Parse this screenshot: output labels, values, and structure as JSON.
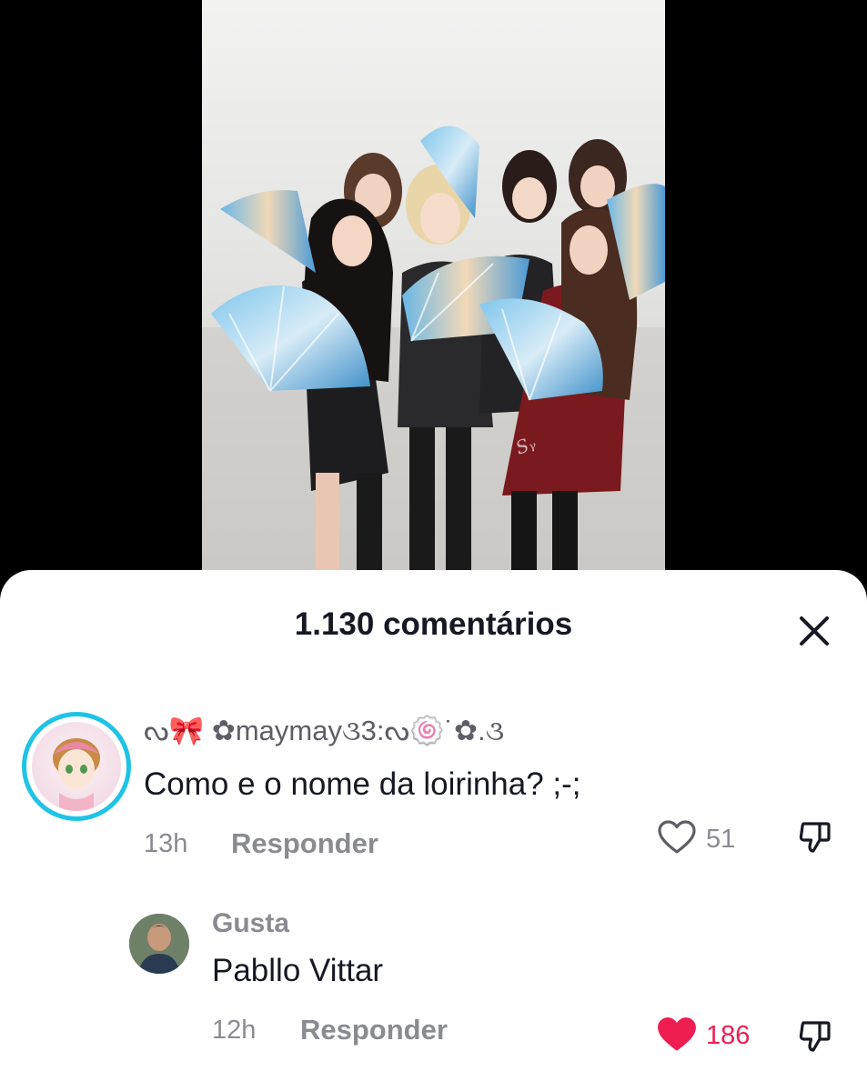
{
  "comments_header": {
    "title": "1.130 comentários"
  },
  "comments": [
    {
      "username": "ᔓ🎀 ✿maymay૩3:ᔓ🍥˙✿.૩",
      "text": "Como e o nome da loirinha? ;-;",
      "time": "13h",
      "reply_label": "Responder",
      "likes": "51",
      "liked": false
    },
    {
      "username": "Gusta",
      "text": "Pabllo Vittar",
      "time": "12h",
      "reply_label": "Responder",
      "likes": "186",
      "liked": true
    }
  ],
  "colors": {
    "liked": "#ee1d52",
    "avatar_ring": "#1fc3e6",
    "muted_text": "#8a8b91",
    "primary_text": "#161823"
  },
  "icons": {
    "close": "close-icon",
    "like": "heart-icon",
    "dislike": "thumbs-down-icon"
  }
}
